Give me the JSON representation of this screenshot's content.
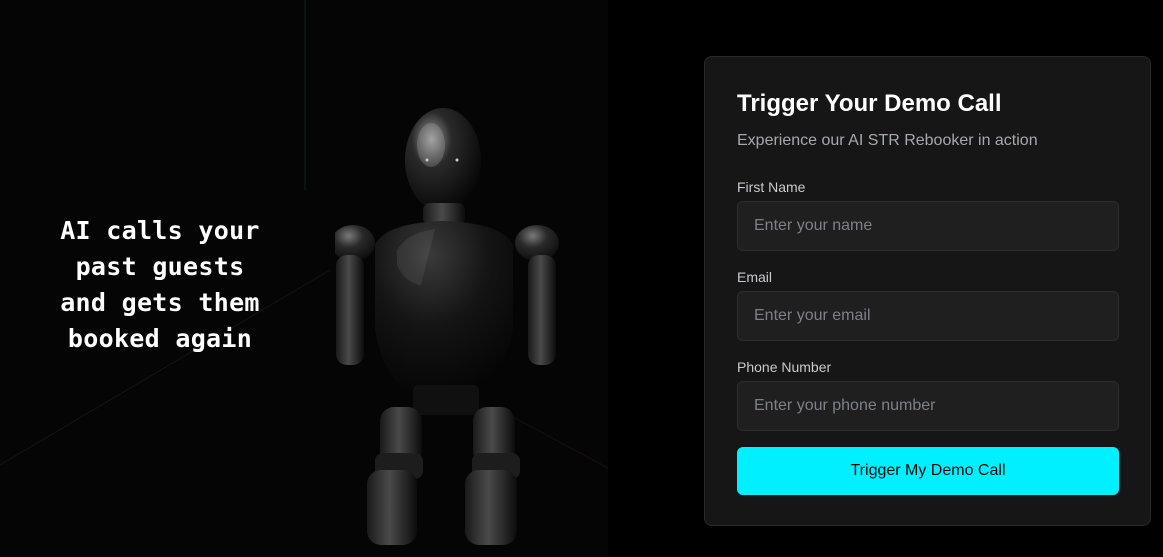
{
  "hero": {
    "headline_lines": [
      "AI calls your",
      "past guests",
      "and gets them",
      "booked again"
    ]
  },
  "form": {
    "title": "Trigger Your Demo Call",
    "subtitle": "Experience our AI STR Rebooker in action",
    "fields": [
      {
        "label": "First Name",
        "placeholder": "Enter your name",
        "value": ""
      },
      {
        "label": "Email",
        "placeholder": "Enter your email",
        "value": ""
      },
      {
        "label": "Phone Number",
        "placeholder": "Enter your phone number",
        "value": ""
      }
    ],
    "submit_label": "Trigger My Demo Call"
  },
  "colors": {
    "page_background": "#000000",
    "card_background": "#161616",
    "input_background": "#1f1f20",
    "accent": "#00f0ff",
    "title_text": "#ffffff",
    "muted_text": "#a5a8b0"
  }
}
